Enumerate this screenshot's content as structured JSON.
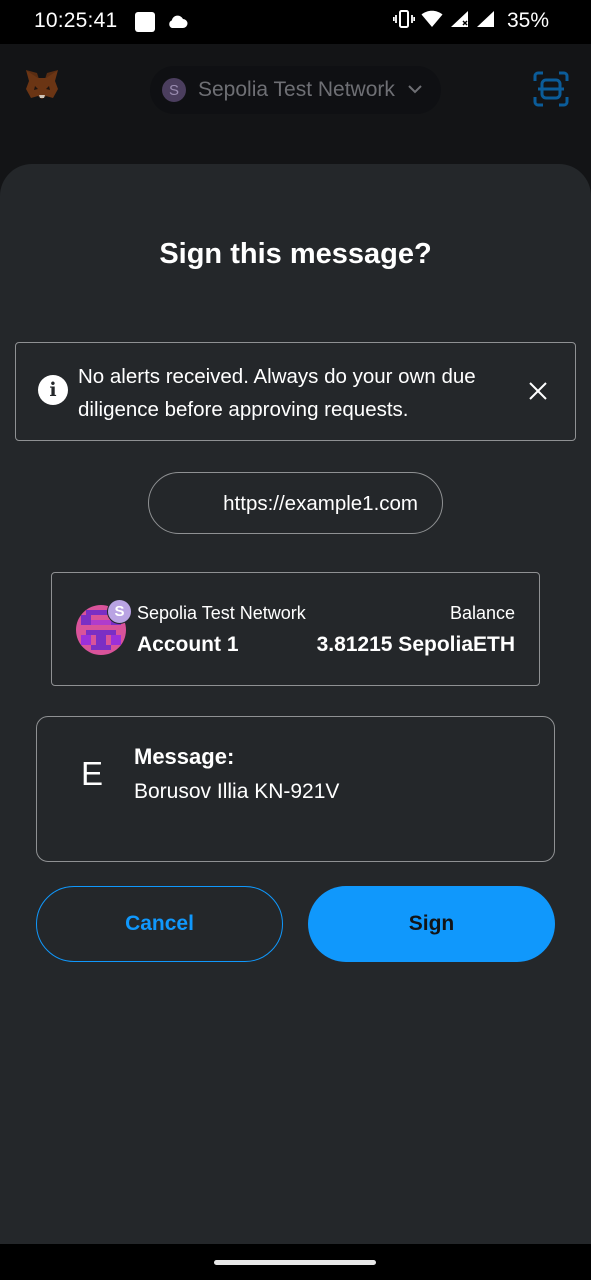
{
  "status_bar": {
    "time": "10:25:41",
    "battery": "35%",
    "icons": [
      "notification-square-icon",
      "cloud-icon",
      "vibrate-icon",
      "wifi-icon",
      "signal-icon",
      "signal-icon",
      "battery-icon"
    ]
  },
  "header": {
    "logo_icon": "metamask-fox-icon",
    "network_initial": "S",
    "network_name": "Sepolia Test Network",
    "scan_icon": "qr-scan-icon"
  },
  "sheet": {
    "title": "Sign this message?",
    "alert": {
      "text": "No alerts received. Always do your own due diligence before approving requests.",
      "icon": "info-icon",
      "close_icon": "close-icon"
    },
    "origin": "https://example1.com",
    "account": {
      "network": "Sepolia Test Network",
      "network_initial": "S",
      "name": "Account 1",
      "balance_label": "Balance",
      "balance": "3.81215 SepoliaETH"
    },
    "message": {
      "letter": "E",
      "label": "Message:",
      "value": "Borusov Illia KN-921V"
    },
    "buttons": {
      "cancel": "Cancel",
      "sign": "Sign"
    }
  },
  "colors": {
    "accent": "#1098fc",
    "sheet_bg": "#24272a",
    "border": "#8f9193"
  }
}
